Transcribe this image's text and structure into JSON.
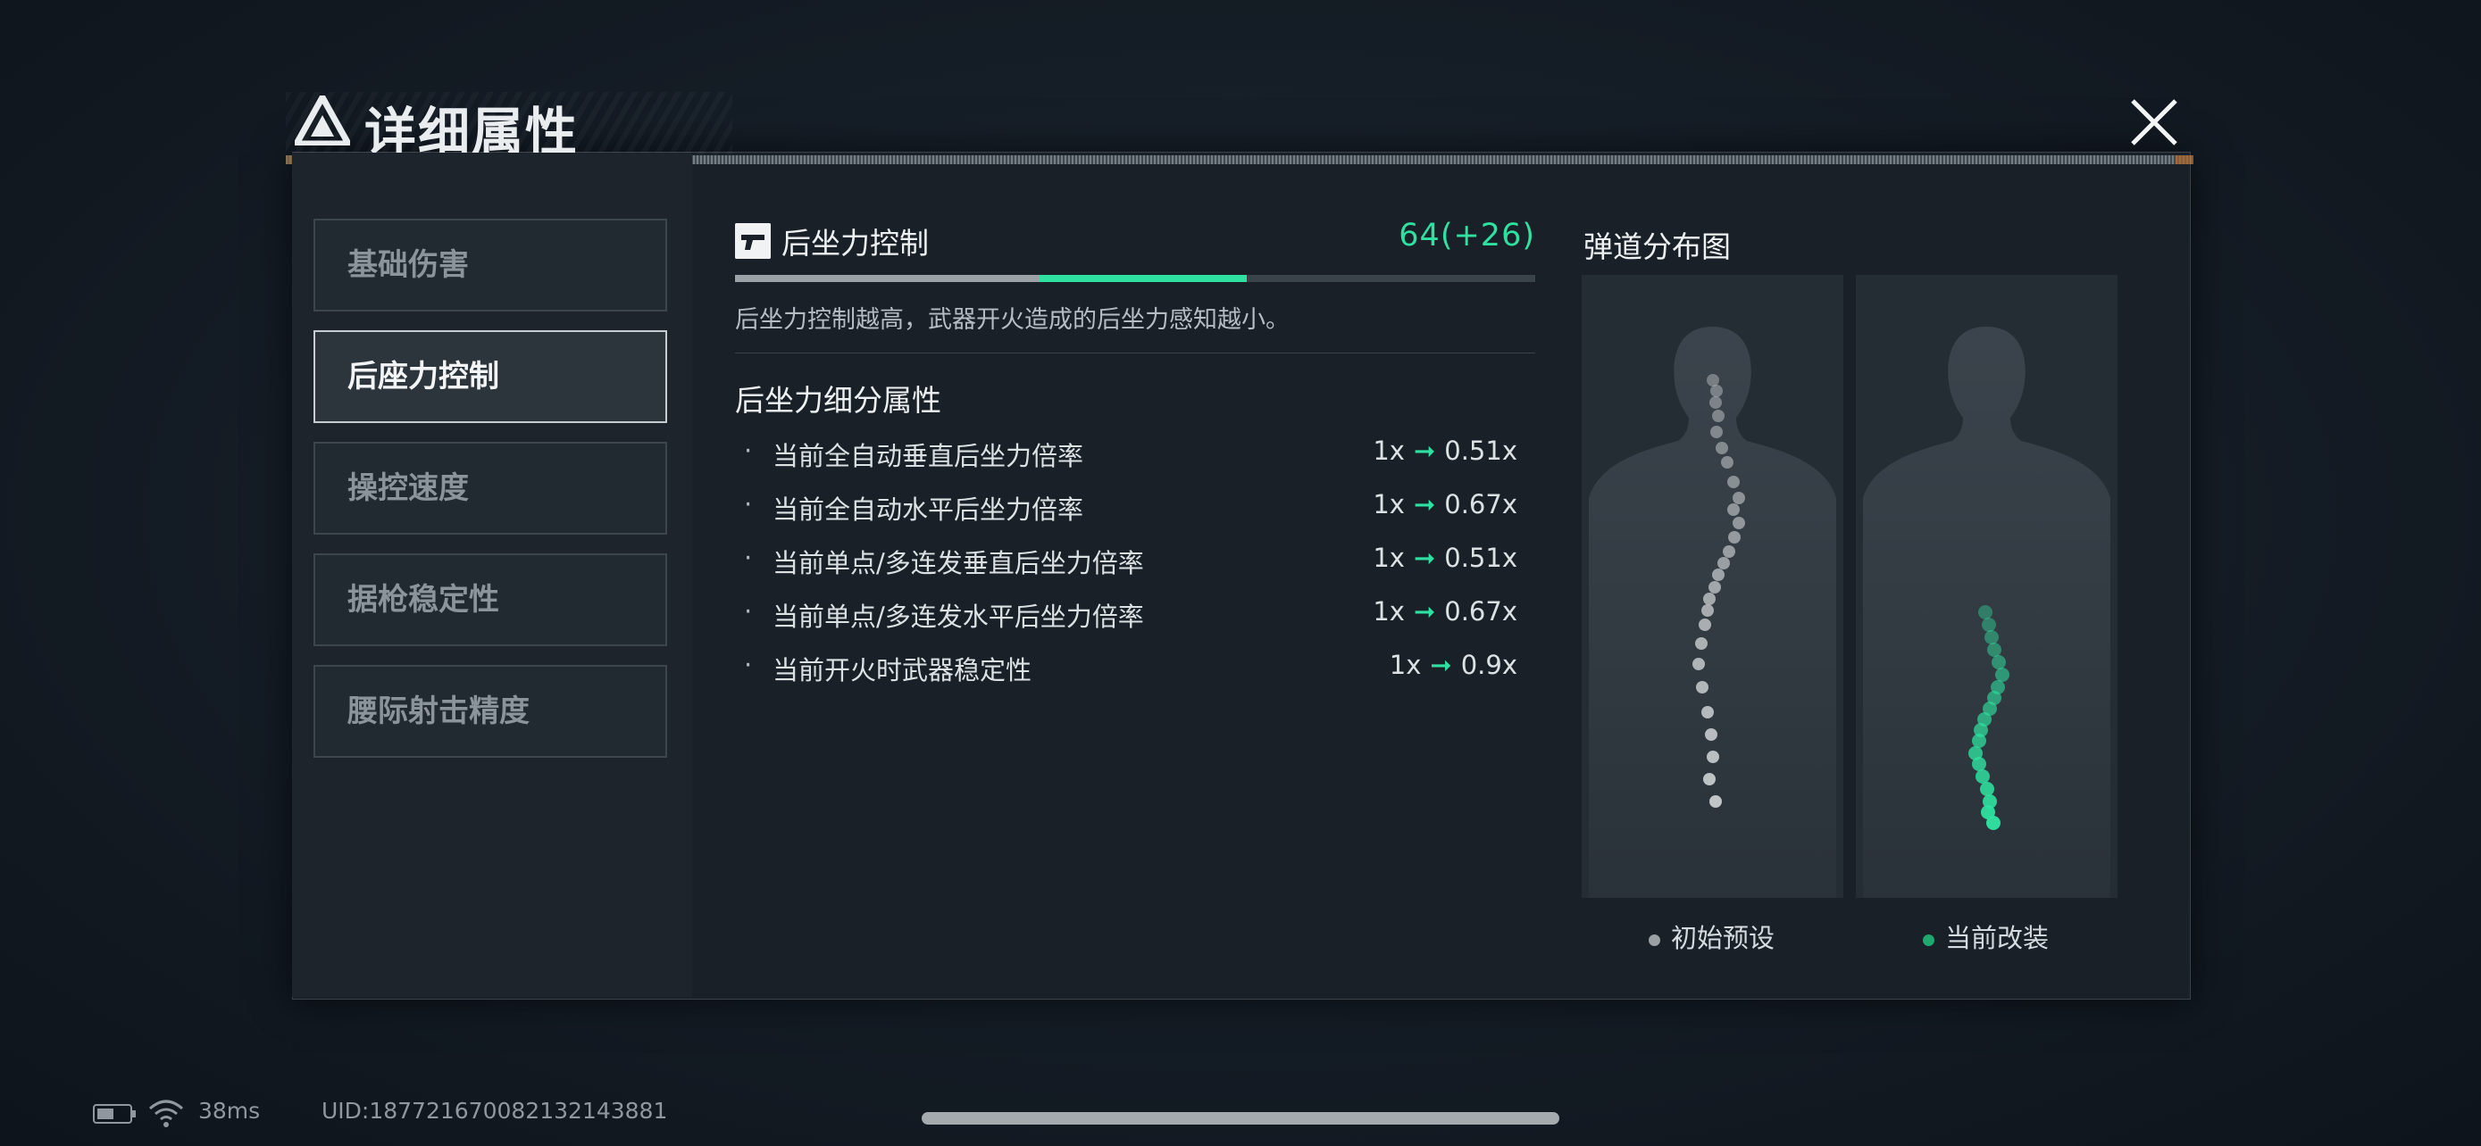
{
  "window": {
    "title": "详细属性"
  },
  "sidebar": {
    "items": [
      {
        "label": "基础伤害",
        "active": false
      },
      {
        "label": "后座力控制",
        "active": true
      },
      {
        "label": "操控速度",
        "active": false
      },
      {
        "label": "据枪稳定性",
        "active": false
      },
      {
        "label": "腰际射击精度",
        "active": false
      }
    ]
  },
  "stat": {
    "title": "后坐力控制",
    "value": "64(+26)",
    "base_fraction": 0.38,
    "total_fraction": 0.64,
    "description": "后坐力控制越高，武器开火造成的后坐力感知越小。",
    "icon": "pistol-icon"
  },
  "sub_section": {
    "title": "后坐力细分属性",
    "rows": [
      {
        "label": "当前全自动垂直后坐力倍率",
        "from": "1x",
        "to": "0.51x"
      },
      {
        "label": "当前全自动水平后坐力倍率",
        "from": "1x",
        "to": "0.67x"
      },
      {
        "label": "当前单点/多连发垂直后坐力倍率",
        "from": "1x",
        "to": "0.51x"
      },
      {
        "label": "当前单点/多连发水平后坐力倍率",
        "from": "1x",
        "to": "0.67x"
      },
      {
        "label": "当前开火时武器稳定性",
        "from": "1x",
        "to": "0.9x"
      }
    ]
  },
  "ballistics": {
    "title": "弹道分布图",
    "legend": {
      "default_label": "初始预设",
      "current_label": "当前改装"
    }
  },
  "status_bar": {
    "ping": "38ms",
    "uid": "UID:18772167008213214388​1"
  },
  "colors": {
    "accent": "#2fe1a0",
    "default_dot": "#c4c8cb",
    "current_dot": "#2fe1a0"
  }
}
